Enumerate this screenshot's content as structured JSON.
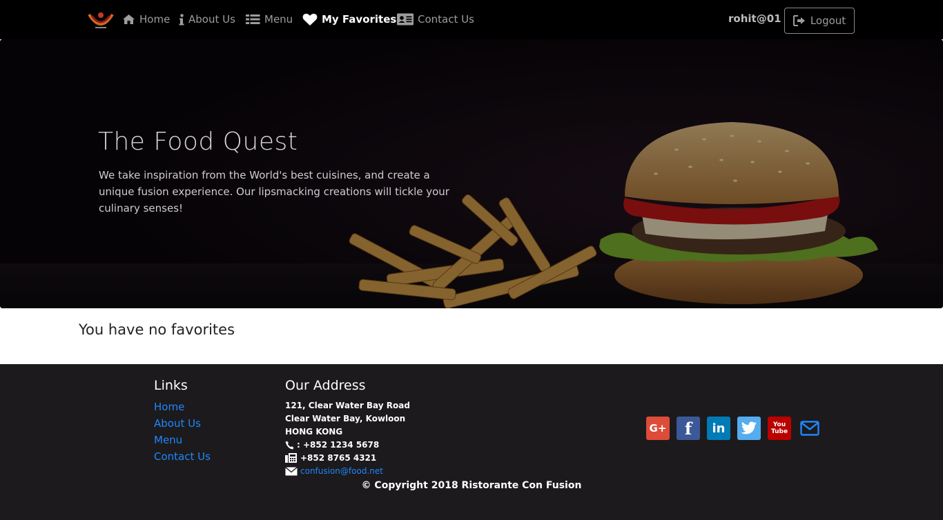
{
  "navbar": {
    "items": [
      {
        "label": "Home",
        "icon": "home-icon"
      },
      {
        "label": "About Us",
        "icon": "info-icon"
      },
      {
        "label": "Menu",
        "icon": "list-icon"
      },
      {
        "label": "My Favorites",
        "icon": "heart-icon",
        "active": true
      },
      {
        "label": "Contact Us",
        "icon": "address-card-icon"
      }
    ],
    "user": "rohit@01",
    "logout_label": "Logout"
  },
  "jumbotron": {
    "title": "The Food Quest",
    "text": "We take inspiration from the World's best cuisines, and create a unique fusion experience. Our lipsmacking creations will tickle your culinary senses!"
  },
  "main": {
    "message": "You have no favorites"
  },
  "footer": {
    "links_heading": "Links",
    "links": [
      "Home",
      "About Us",
      "Menu",
      "Contact Us"
    ],
    "address_heading": "Our Address",
    "address": [
      "121, Clear Water Bay Road",
      "Clear Water Bay, Kowloon",
      "HONG KONG"
    ],
    "phone": ": +852 1234 5678",
    "fax": "+852 8765 4321",
    "email": "confusion@food.net",
    "social": [
      {
        "name": "google-plus-icon",
        "color": "#dd4b39",
        "glyph": "G+"
      },
      {
        "name": "facebook-icon",
        "color": "#3b5998",
        "glyph": "f"
      },
      {
        "name": "linkedin-icon",
        "color": "#007bb6",
        "glyph": "in"
      },
      {
        "name": "twitter-icon",
        "color": "#55acee",
        "glyph": "t"
      },
      {
        "name": "youtube-icon",
        "color": "#bb0000",
        "glyph": "You Tube"
      },
      {
        "name": "mail-icon",
        "color": "#1e88ff",
        "glyph": "✉"
      }
    ],
    "copyright": "© Copyright 2018 Ristorante Con Fusion"
  },
  "colors": {
    "navbar_bg": "#000000",
    "footer_bg": "#1c1a1c",
    "link": "#1e88ff"
  }
}
